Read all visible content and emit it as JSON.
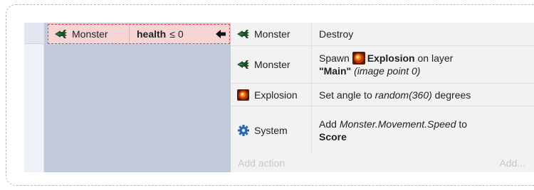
{
  "colors": {
    "condition_bg": "#f8d5d5",
    "condition_border": "#e04848",
    "conditions_block_bg": "#c2c9d9",
    "actions_bg": "#f2f2f2",
    "monster_icon": "#1e4f2a",
    "system_icon": "#2b6cb0",
    "placeholder_text": "#c8c8c8"
  },
  "condition": {
    "object": "Monster",
    "object_icon": "monster-icon",
    "keyword": "health",
    "operator": "≤",
    "value": "0",
    "marker_icon": "arrow-left-icon"
  },
  "actions": [
    {
      "object": "Monster",
      "object_icon": "monster-icon",
      "text": "Destroy"
    },
    {
      "object": "Monster",
      "object_icon": "monster-icon",
      "pre": "Spawn",
      "target_icon": "explosion-icon",
      "target": "Explosion",
      "mid": "on layer",
      "layer": "\"Main\"",
      "post": "(image point 0)"
    },
    {
      "object": "Explosion",
      "object_icon": "explosion-icon",
      "pre": "Set angle to",
      "expression": "random(360)",
      "post": "degrees"
    },
    {
      "object": "System",
      "object_icon": "gear-icon",
      "pre": "Add",
      "expression": "Monster.Movement.Speed",
      "mid": "to",
      "target": "Score"
    }
  ],
  "add_action_label": "Add action",
  "add_more_label": "Add..."
}
